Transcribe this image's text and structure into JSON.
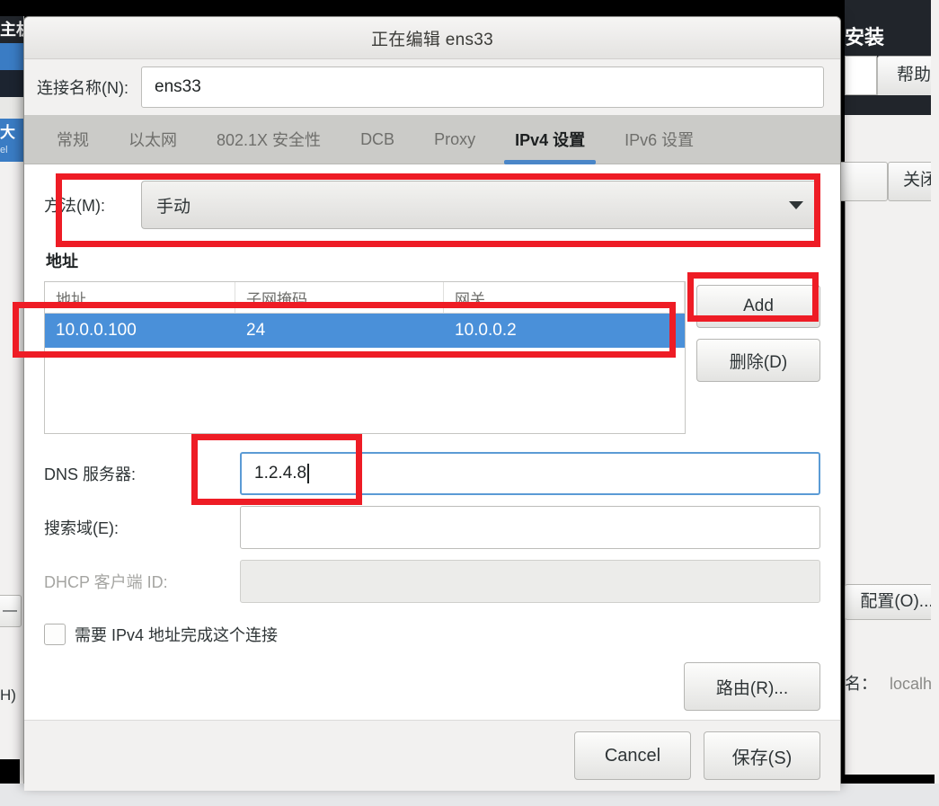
{
  "background": {
    "left_window": {
      "header_fragment": "主机",
      "blue_row_fragment": "",
      "blue_row2_title": "大",
      "blue_row2_sub": "el",
      "button_fragment": "—",
      "text_fragment": "H)"
    },
    "right_window": {
      "title_fragment": "安装",
      "help_label": "帮助",
      "close_label": "关闭",
      "config_label": "配置(O)...",
      "host_label": "名：",
      "host_value": "localh"
    }
  },
  "dialog": {
    "title": "正在编辑 ens33",
    "connection_name": {
      "label": "连接名称(N):",
      "value": "ens33"
    },
    "tabs": [
      {
        "label": "常规",
        "active": false
      },
      {
        "label": "以太网",
        "active": false
      },
      {
        "label": "802.1X 安全性",
        "active": false
      },
      {
        "label": "DCB",
        "active": false
      },
      {
        "label": "Proxy",
        "active": false
      },
      {
        "label": "IPv4 设置",
        "active": true
      },
      {
        "label": "IPv6 设置",
        "active": false
      }
    ],
    "method": {
      "label": "方法(M):",
      "value": "手动"
    },
    "addresses": {
      "section_title": "地址",
      "columns": [
        "地址",
        "子网掩码",
        "网关"
      ],
      "rows": [
        {
          "address": "10.0.0.100",
          "netmask": "24",
          "gateway": "10.0.0.2",
          "selected": true
        }
      ],
      "add_label": "Add",
      "delete_label": "删除(D)"
    },
    "dns": {
      "label": "DNS 服务器:",
      "value": "1.2.4.8",
      "focused": true
    },
    "search_domains": {
      "label": "搜索域(E):",
      "value": ""
    },
    "dhcp_client_id": {
      "label": "DHCP 客户端 ID:",
      "value": "",
      "disabled": true
    },
    "require_ipv4": {
      "label": "需要 IPv4 地址完成这个连接",
      "checked": false
    },
    "routes_label": "路由(R)...",
    "cancel_label": "Cancel",
    "save_label": "保存(S)"
  },
  "annotations": {
    "accent_color": "#ee1c25",
    "boxes": [
      "method-dropdown",
      "address-row",
      "add-button",
      "dns-field"
    ]
  },
  "colors": {
    "selection_blue": "#4a90d9",
    "tab_underline": "#4a86c8",
    "annotation_red": "#ee1c25"
  }
}
